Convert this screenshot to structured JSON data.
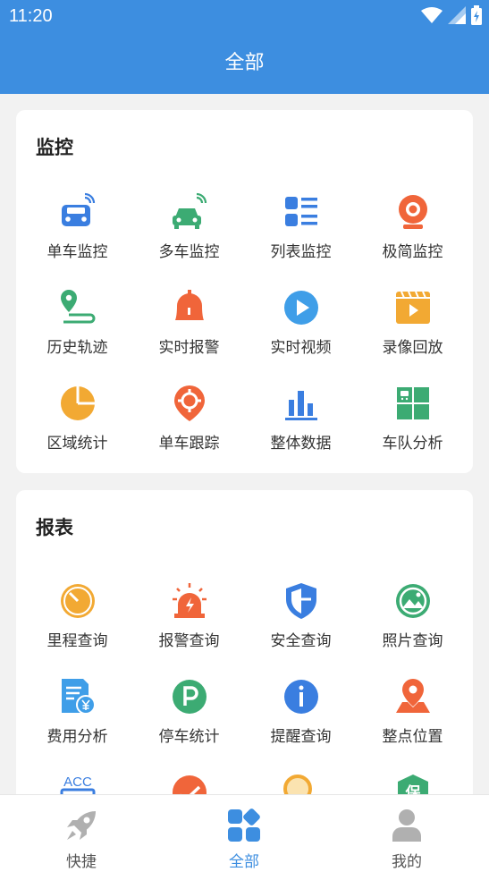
{
  "status": {
    "time": "11:20"
  },
  "header": {
    "title": "全部"
  },
  "sections": [
    {
      "title": "监控",
      "items": [
        {
          "label": "单车监控",
          "icon": "car-signal-icon"
        },
        {
          "label": "多车监控",
          "icon": "multi-car-icon"
        },
        {
          "label": "列表监控",
          "icon": "list-icon"
        },
        {
          "label": "极简监控",
          "icon": "camera-icon"
        },
        {
          "label": "历史轨迹",
          "icon": "track-icon"
        },
        {
          "label": "实时报警",
          "icon": "bell-icon"
        },
        {
          "label": "实时视频",
          "icon": "play-icon"
        },
        {
          "label": "录像回放",
          "icon": "video-icon"
        },
        {
          "label": "区域统计",
          "icon": "pie-icon"
        },
        {
          "label": "单车跟踪",
          "icon": "target-pin-icon"
        },
        {
          "label": "整体数据",
          "icon": "bar-chart-icon"
        },
        {
          "label": "车队分析",
          "icon": "fleet-grid-icon"
        }
      ]
    },
    {
      "title": "报表",
      "items": [
        {
          "label": "里程查询",
          "icon": "speedometer-icon"
        },
        {
          "label": "报警查询",
          "icon": "siren-icon"
        },
        {
          "label": "安全查询",
          "icon": "shield-icon"
        },
        {
          "label": "照片查询",
          "icon": "photo-icon"
        },
        {
          "label": "费用分析",
          "icon": "cost-doc-icon"
        },
        {
          "label": "停车统计",
          "icon": "parking-icon"
        },
        {
          "label": "提醒查询",
          "icon": "info-icon"
        },
        {
          "label": "整点位置",
          "icon": "location-icon"
        },
        {
          "label": "",
          "icon": "acc-icon",
          "glyph": "ACC"
        },
        {
          "label": "",
          "icon": "trend-icon"
        },
        {
          "label": "",
          "icon": "search-icon"
        },
        {
          "label": "",
          "icon": "insurance-icon",
          "glyph": "保"
        }
      ]
    }
  ],
  "tabs": [
    {
      "label": "快捷",
      "icon": "rocket-icon",
      "active": false
    },
    {
      "label": "全部",
      "icon": "all-apps-icon",
      "active": true
    },
    {
      "label": "我的",
      "icon": "user-icon",
      "active": false
    }
  ],
  "colors": {
    "primary": "#3d8ee0",
    "blue": "#3a7ee0",
    "green": "#3cab73",
    "orange": "#f0653a",
    "amber": "#f2a933"
  }
}
